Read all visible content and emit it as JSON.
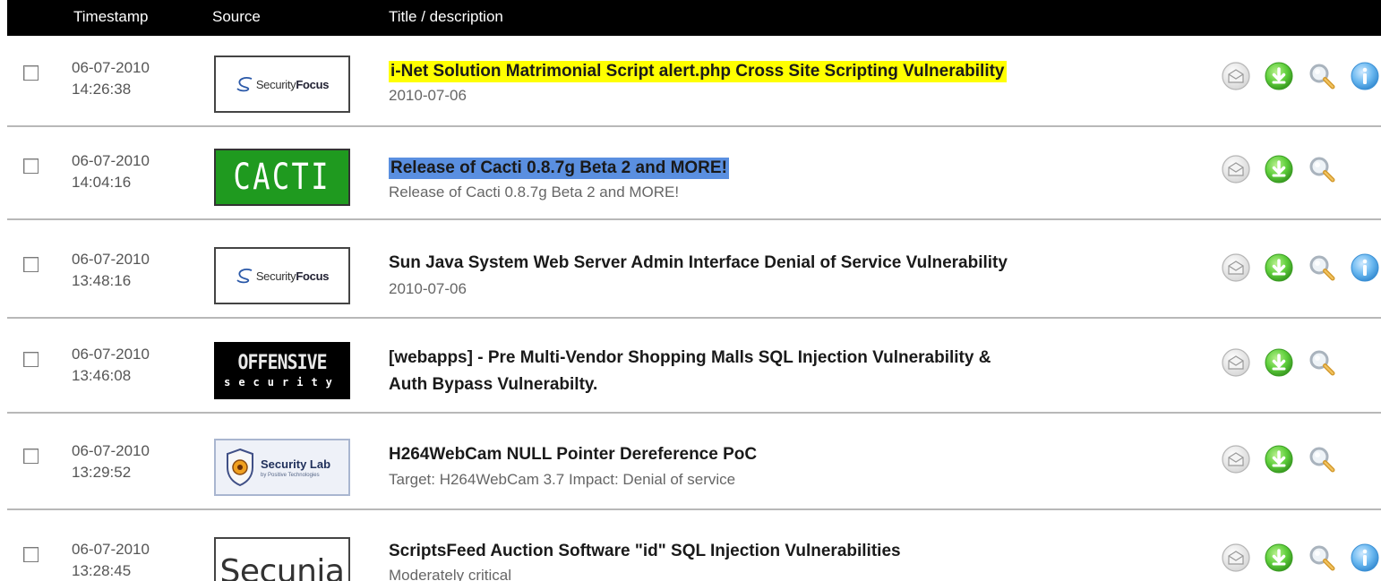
{
  "header": {
    "timestamp": "Timestamp",
    "source": "Source",
    "title": "Title / description"
  },
  "rows": [
    {
      "date": "06-07-2010",
      "time": "14:26:38",
      "source": "SecurityFocus",
      "source_parts": [
        "Security",
        "Focus"
      ],
      "title": "i-Net Solution Matrimonial Script alert.php Cross Site Scripting Vulnerability",
      "desc": "2010-07-06",
      "highlight": "yellow",
      "has_info": true
    },
    {
      "date": "06-07-2010",
      "time": "14:04:16",
      "source": "CACTI",
      "title": "Release of Cacti 0.8.7g Beta 2 and MORE!",
      "desc": "Release of Cacti 0.8.7g Beta 2 and MORE!",
      "highlight": "blue",
      "has_info": false
    },
    {
      "date": "06-07-2010",
      "time": "13:48:16",
      "source": "SecurityFocus",
      "source_parts": [
        "Security",
        "Focus"
      ],
      "title": "Sun Java System Web Server Admin Interface Denial of Service Vulnerability",
      "desc": "2010-07-06",
      "highlight": "none",
      "has_info": true
    },
    {
      "date": "06-07-2010",
      "time": "13:46:08",
      "source": "OFFENSIVE security",
      "source_parts": [
        "OFFENSIVE",
        "security"
      ],
      "title_line1": "[webapps] - Pre Multi-Vendor Shopping Malls SQL Injection Vulnerability &",
      "title_line2": "Auth Bypass Vulnerabilty.",
      "highlight": "none",
      "has_info": false
    },
    {
      "date": "06-07-2010",
      "time": "13:29:52",
      "source": "Security Lab by Positive Technologies",
      "source_parts": [
        "Security Lab",
        "by Positive Technologies"
      ],
      "title": "H264WebCam NULL Pointer Dereference PoC",
      "desc": "Target: H264WebCam 3.7 Impact: Denial of service",
      "highlight": "none",
      "has_info": false
    },
    {
      "date": "06-07-2010",
      "time": "13:28:45",
      "source": "Secunia",
      "title": "ScriptsFeed Auction Software \"id\" SQL Injection Vulnerabilities",
      "desc": "Moderately critical",
      "highlight": "none",
      "has_info": true
    }
  ],
  "icons": {
    "mail": "envelope-icon",
    "download": "download-icon",
    "search": "magnifier-icon",
    "info": "info-icon"
  },
  "colors": {
    "header_bg": "#000000",
    "highlight_yellow": "#ffff00",
    "highlight_blue": "#5a8fe0",
    "download_green": "#5fcf3c",
    "info_blue": "#4aa6e8"
  }
}
